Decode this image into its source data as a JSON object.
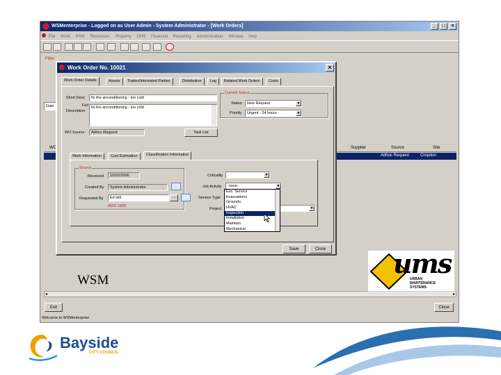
{
  "app": {
    "title": "WSMenterprise - Logged on as User Admin - System Administrator - [Work Orders]",
    "menu": [
      "File",
      "Work",
      "RSM",
      "Resources",
      "Property",
      "OHS",
      "Financial",
      "Reporting",
      "Administration",
      "Window",
      "Help"
    ],
    "window_controls": [
      "_",
      "□",
      "×"
    ],
    "filter_label": "Filter",
    "side_label": "Date",
    "grid": {
      "headers": [
        "WO",
        "Supplier",
        "Source",
        "Site"
      ],
      "selected_row": {
        "source": "Adhoc Request",
        "site": "Croydon"
      }
    },
    "exit_label": "Exit",
    "close_label": "Close",
    "status_text": "Welcome to WSMenterprise"
  },
  "dialog": {
    "title": "Work Order No. 10021",
    "close_glyph": "×",
    "tabs": [
      "Work Order Details",
      "Assets",
      "Trades/Interested Parties",
      "Distribution",
      "Log",
      "Related Work Orders",
      "Costs"
    ],
    "short_desc_label": "Short Desc",
    "short_desc_value": "fix the airconditioning - too cold",
    "full_desc_label_1": "Full",
    "full_desc_label_2": "Description",
    "full_desc_value": "fix the airconditioning - too cold",
    "wo_source_label": "WO Source",
    "wo_source_value": "Adhoc Request",
    "task_list_label": "Task List",
    "current_status_title": "Current Status",
    "status_label": "Status",
    "status_value": "New Request",
    "priority_label": "Priority",
    "priority_value": "Urgent - 24 hours",
    "subtabs": [
      "Work Information",
      "Cost Estimation",
      "Classification Information"
    ],
    "source_group_title": "Source",
    "received_label": "Received",
    "received_value": "10/02/2006",
    "created_by_label": "Created By",
    "created_by_value": "System Administrator",
    "requested_by_label": "Requested By",
    "requested_by_value": "Ed Hill",
    "requested_by_phone": "9600 1888",
    "criticality_label": "Criticality",
    "job_activity_label": "Job Activity",
    "job_activity_value": "-none-",
    "service_type_label": "Service Type",
    "project_label": "Project",
    "dropdown_items": [
      "Ess. Service",
      "Evacuations",
      "Grounds",
      "HVAC",
      "Inspection",
      "Installation",
      "Maintain",
      "Mechanical"
    ],
    "dropdown_selected_index": 4,
    "ellipsis_label": "...",
    "save_label": "Save",
    "close_label": "Close"
  },
  "overlay_text": "WSM",
  "ums_logo": {
    "big": "ums",
    "line1": "URBAN",
    "line2": "MAINTENANCE",
    "line3": "SYSTEMS"
  },
  "bayside_logo": {
    "name": "Bayside",
    "sub": "CITY COUNCIL"
  },
  "colors": {
    "titlebar": "#0a246a",
    "selection": "#0a246a",
    "group_title": "#b03030",
    "bayside_blue": "#1d4d8f",
    "ums_yellow": "#f2c200"
  }
}
